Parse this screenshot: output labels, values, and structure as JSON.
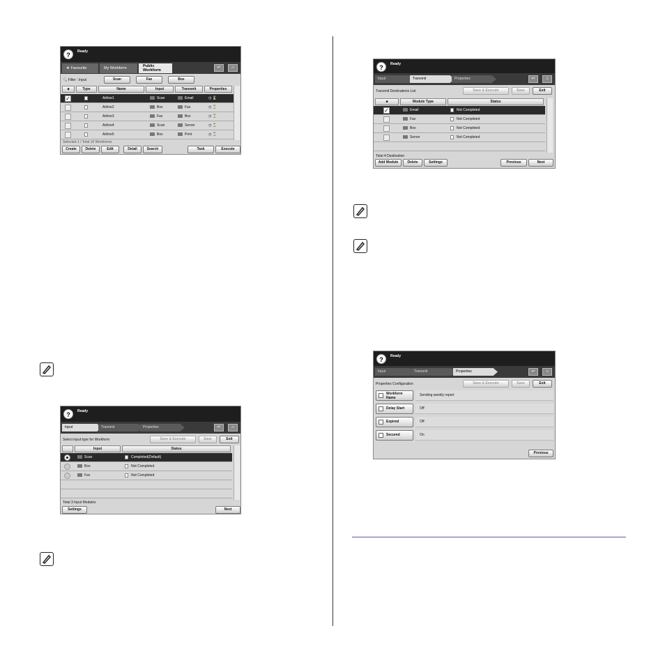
{
  "screens": {
    "s1": {
      "status": "Ready",
      "tabs": [
        "Favourite",
        "My Workform",
        "Public\nWorkform"
      ],
      "filter_label": "Filter : Input",
      "filter_buttons": [
        "Scan",
        "Fax",
        "Box"
      ],
      "headers": [
        "Type",
        "Name",
        "Input",
        "Transmit",
        "Properties"
      ],
      "rows": [
        {
          "name": "Airline1",
          "input": "Scan",
          "transmit": "Email",
          "selected": true
        },
        {
          "name": "Airline2",
          "input": "Box",
          "transmit": "Fax",
          "selected": false
        },
        {
          "name": "Airline3",
          "input": "Fax",
          "transmit": "Box",
          "selected": false
        },
        {
          "name": "Airline4",
          "input": "Scan",
          "transmit": "Server",
          "selected": false
        },
        {
          "name": "Airline5",
          "input": "Box",
          "transmit": "Print",
          "selected": false
        }
      ],
      "footer_text": "Selected 1 / Total 10 Workforms",
      "buttons": [
        "Create",
        "Delete",
        "Edit",
        "Detail",
        "Search",
        "Task",
        "Execute"
      ]
    },
    "s2": {
      "status": "Ready",
      "steps": [
        "Input",
        "Transmit",
        "Properties"
      ],
      "title": "Transmit Destinations List",
      "save_execute": "Save & Execute",
      "save": "Save",
      "exit": "Exit",
      "headers": [
        "Module Type",
        "Status"
      ],
      "rows": [
        {
          "type": "Email",
          "status": "Not Completed",
          "selected": true
        },
        {
          "type": "Fax",
          "status": "Not Completed",
          "selected": false
        },
        {
          "type": "Box",
          "status": "Not Completed",
          "selected": false
        },
        {
          "type": "Server",
          "status": "Not Completed",
          "selected": false
        }
      ],
      "total": "Total 4 Destination",
      "buttons": [
        "Add Module",
        "Delete",
        "Settings",
        "Previous",
        "Next"
      ]
    },
    "s3": {
      "status": "Ready",
      "steps": [
        "Input",
        "Transmit",
        "Properties"
      ],
      "title": "Select input type for Workform",
      "save_execute": "Save & Execute",
      "save": "Save",
      "exit": "Exit",
      "headers": [
        "Input",
        "Status"
      ],
      "rows": [
        {
          "type": "Scan",
          "status": "Completed(Default)",
          "selected": true
        },
        {
          "type": "Box",
          "status": "Not Completed",
          "selected": false
        },
        {
          "type": "Fax",
          "status": "Not Completed",
          "selected": false
        }
      ],
      "total": "Total 3 Input Modules",
      "buttons": [
        "Settings",
        "Next"
      ]
    },
    "s4": {
      "status": "Ready",
      "steps": [
        "Input",
        "Transmit",
        "Properties"
      ],
      "title": "Properties Configuration",
      "save_execute": "Save & Execute",
      "save": "Save",
      "exit": "Exit",
      "props": [
        {
          "label": "Workform Name",
          "value": "Sending weekly report"
        },
        {
          "label": "Delay Start",
          "value": "Off"
        },
        {
          "label": "Expired",
          "value": "Off"
        },
        {
          "label": "Secured",
          "value": "On"
        }
      ],
      "buttons": [
        "Previous"
      ]
    }
  }
}
